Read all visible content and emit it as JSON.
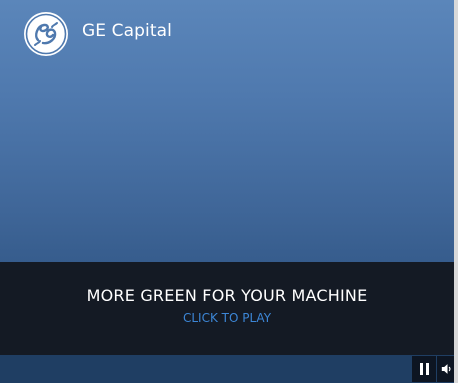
{
  "brand": {
    "logo_icon": "ge-monogram-logo",
    "name": "GE Capital"
  },
  "caption": {
    "headline": "MORE GREEN FOR YOUR MACHINE",
    "cta": "CLICK TO PLAY"
  },
  "controls": {
    "pause_icon": "pause-icon",
    "volume_icon": "speaker-icon"
  },
  "colors": {
    "background_top": "#5b86ba",
    "background_bottom": "#264a77",
    "caption_band": "#141a24",
    "cta_text": "#3c86d6",
    "control_bar": "#1f3e63"
  }
}
